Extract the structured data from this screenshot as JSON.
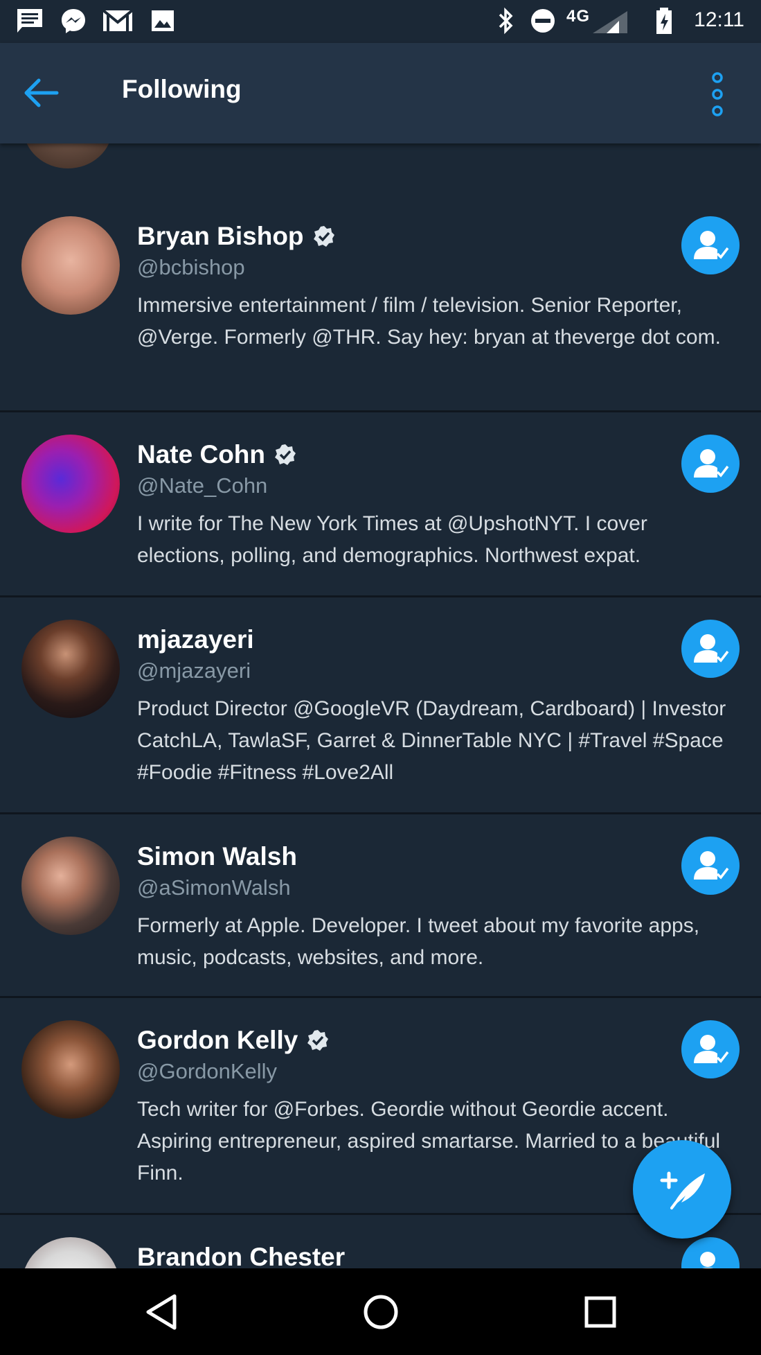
{
  "status_bar": {
    "time": "12:11",
    "network": "4G",
    "icons": [
      "message-icon",
      "messenger-icon",
      "gmail-icon",
      "photo-icon",
      "bluetooth-icon",
      "do-not-disturb-icon",
      "signal-icon",
      "battery-charging-icon"
    ]
  },
  "app_bar": {
    "title": "Following",
    "back_icon": "arrow-left-icon",
    "menu_icon": "more-vert-icon",
    "accent_color": "#1da1f2"
  },
  "users": [
    {
      "name": "Bryan Bishop",
      "handle": "@bcbishop",
      "verified": true,
      "bio": "Immersive entertainment / film / television. Senior Reporter, @Verge. Formerly @THR. Say hey: bryan at theverge dot com."
    },
    {
      "name": "Nate Cohn",
      "handle": "@Nate_Cohn",
      "verified": true,
      "bio": "I write for The New York Times at @UpshotNYT. I cover elections, polling, and demographics. Northwest expat."
    },
    {
      "name": "mjazayeri",
      "handle": "@mjazayeri",
      "verified": false,
      "bio": "Product Director @GoogleVR (Daydream, Cardboard) | Investor CatchLA, TawlaSF, Garret & DinnerTable NYC | #Travel #Space #Foodie #Fitness #Love2All"
    },
    {
      "name": "Simon Walsh",
      "handle": "@aSimonWalsh",
      "verified": false,
      "bio": "Formerly at Apple. Developer. I tweet about my favorite apps, music, podcasts, websites, and more."
    },
    {
      "name": "Gordon Kelly",
      "handle": "@GordonKelly",
      "verified": true,
      "bio": "Tech writer for @Forbes. Geordie without Geordie accent. Aspiring entrepreneur, aspired smartarse. Married to a beautiful Finn."
    },
    {
      "name": "Brandon Chester",
      "handle": "",
      "verified": false,
      "bio": ""
    }
  ],
  "follow_button_icon": "person-check-icon",
  "compose_fab_icon": "compose-tweet-icon",
  "nav_bar": {
    "back_icon": "nav-back-triangle-icon",
    "home_icon": "nav-home-circle-icon",
    "recents_icon": "nav-recents-square-icon"
  }
}
